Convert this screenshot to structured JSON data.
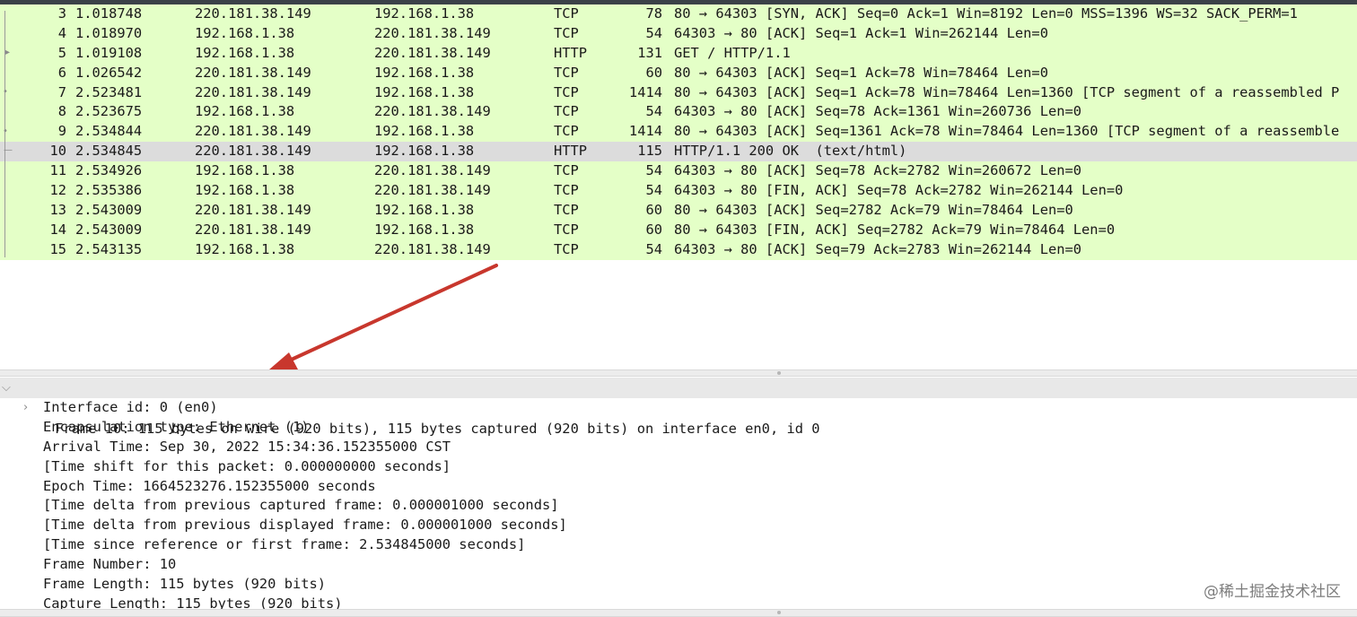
{
  "packets": [
    {
      "no": "3",
      "time": "1.018748",
      "src": "220.181.38.149",
      "dst": "192.168.1.38",
      "proto": "TCP",
      "len": "78",
      "info": "80 → 64303 [SYN, ACK] Seq=0 Ack=1 Win=8192 Len=0 MSS=1396 WS=32 SACK_PERM=1"
    },
    {
      "no": "4",
      "time": "1.018970",
      "src": "192.168.1.38",
      "dst": "220.181.38.149",
      "proto": "TCP",
      "len": "54",
      "info": "64303 → 80 [ACK] Seq=1 Ack=1 Win=262144 Len=0"
    },
    {
      "no": "5",
      "time": "1.019108",
      "src": "192.168.1.38",
      "dst": "220.181.38.149",
      "proto": "HTTP",
      "len": "131",
      "info": "GET / HTTP/1.1"
    },
    {
      "no": "6",
      "time": "1.026542",
      "src": "220.181.38.149",
      "dst": "192.168.1.38",
      "proto": "TCP",
      "len": "60",
      "info": "80 → 64303 [ACK] Seq=1 Ack=78 Win=78464 Len=0"
    },
    {
      "no": "7",
      "time": "2.523481",
      "src": "220.181.38.149",
      "dst": "192.168.1.38",
      "proto": "TCP",
      "len": "1414",
      "info": "80 → 64303 [ACK] Seq=1 Ack=78 Win=78464 Len=1360 [TCP segment of a reassembled P"
    },
    {
      "no": "8",
      "time": "2.523675",
      "src": "192.168.1.38",
      "dst": "220.181.38.149",
      "proto": "TCP",
      "len": "54",
      "info": "64303 → 80 [ACK] Seq=78 Ack=1361 Win=260736 Len=0"
    },
    {
      "no": "9",
      "time": "2.534844",
      "src": "220.181.38.149",
      "dst": "192.168.1.38",
      "proto": "TCP",
      "len": "1414",
      "info": "80 → 64303 [ACK] Seq=1361 Ack=78 Win=78464 Len=1360 [TCP segment of a reassemble"
    },
    {
      "no": "10",
      "time": "2.534845",
      "src": "220.181.38.149",
      "dst": "192.168.1.38",
      "proto": "HTTP",
      "len": "115",
      "info": "HTTP/1.1 200 OK  (text/html)"
    },
    {
      "no": "11",
      "time": "2.534926",
      "src": "192.168.1.38",
      "dst": "220.181.38.149",
      "proto": "TCP",
      "len": "54",
      "info": "64303 → 80 [ACK] Seq=78 Ack=2782 Win=260672 Len=0"
    },
    {
      "no": "12",
      "time": "2.535386",
      "src": "192.168.1.38",
      "dst": "220.181.38.149",
      "proto": "TCP",
      "len": "54",
      "info": "64303 → 80 [FIN, ACK] Seq=78 Ack=2782 Win=262144 Len=0"
    },
    {
      "no": "13",
      "time": "2.543009",
      "src": "220.181.38.149",
      "dst": "192.168.1.38",
      "proto": "TCP",
      "len": "60",
      "info": "80 → 64303 [ACK] Seq=2782 Ack=79 Win=78464 Len=0"
    },
    {
      "no": "14",
      "time": "2.543009",
      "src": "220.181.38.149",
      "dst": "192.168.1.38",
      "proto": "TCP",
      "len": "60",
      "info": "80 → 64303 [FIN, ACK] Seq=2782 Ack=79 Win=78464 Len=0"
    },
    {
      "no": "15",
      "time": "2.543135",
      "src": "192.168.1.38",
      "dst": "220.181.38.149",
      "proto": "TCP",
      "len": "54",
      "info": "64303 → 80 [ACK] Seq=79 Ack=2783 Win=262144 Len=0"
    }
  ],
  "selected_packet_no": "10",
  "details": {
    "frame_header": "Frame 10: 115 bytes on wire (920 bits), 115 bytes captured (920 bits) on interface en0, id 0",
    "fields": [
      {
        "text": "Interface id: 0 (en0)",
        "expandable": true
      },
      {
        "text": "Encapsulation type: Ethernet (1)",
        "expandable": false
      },
      {
        "text": "Arrival Time: Sep 30, 2022 15:34:36.152355000 CST",
        "expandable": false
      },
      {
        "text": "[Time shift for this packet: 0.000000000 seconds]",
        "expandable": false
      },
      {
        "text": "Epoch Time: 1664523276.152355000 seconds",
        "expandable": false
      },
      {
        "text": "[Time delta from previous captured frame: 0.000001000 seconds]",
        "expandable": false
      },
      {
        "text": "[Time delta from previous displayed frame: 0.000001000 seconds]",
        "expandable": false
      },
      {
        "text": "[Time since reference or first frame: 2.534845000 seconds]",
        "expandable": false
      },
      {
        "text": "Frame Number: 10",
        "expandable": false
      },
      {
        "text": "Frame Length: 115 bytes (920 bits)",
        "expandable": false
      },
      {
        "text": "Capture Length: 115 bytes (920 bits)",
        "expandable": false
      }
    ]
  },
  "icons": {
    "expanded": "chevron-down-icon",
    "collapsed": "chevron-right-icon"
  },
  "colors": {
    "tcp_row": "#e4ffc7",
    "selected_row": "#dcdcdc",
    "annotation_arrow": "#c8372d",
    "toolbar": "#3b4148"
  },
  "watermark": "@稀土掘金技术社区"
}
